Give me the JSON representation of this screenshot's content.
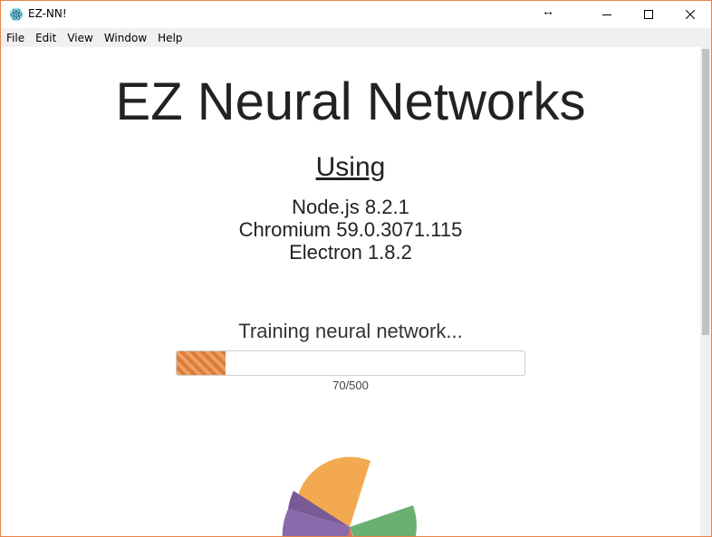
{
  "window": {
    "title": "EZ-NN!",
    "resize_glyph": "↔"
  },
  "menu": [
    "File",
    "Edit",
    "View",
    "Window",
    "Help"
  ],
  "main": {
    "heading": "EZ Neural Networks",
    "using_label": "Using",
    "versions": [
      "Node.js 8.2.1",
      "Chromium 59.0.3071.115",
      "Electron 1.8.2"
    ],
    "status": "Training neural network...",
    "progress": {
      "current": 70,
      "total": 500,
      "label": "70/500"
    }
  },
  "colors": {
    "accent": "#e8843a",
    "border": "#e8834a",
    "pie": [
      "#f0a044",
      "#7c5a9c",
      "#6aab6a",
      "#e06a4c"
    ]
  },
  "icons": {
    "app": "electron-atom-icon",
    "minimize": "minimize-icon",
    "maximize": "maximize-icon",
    "close": "close-icon"
  }
}
